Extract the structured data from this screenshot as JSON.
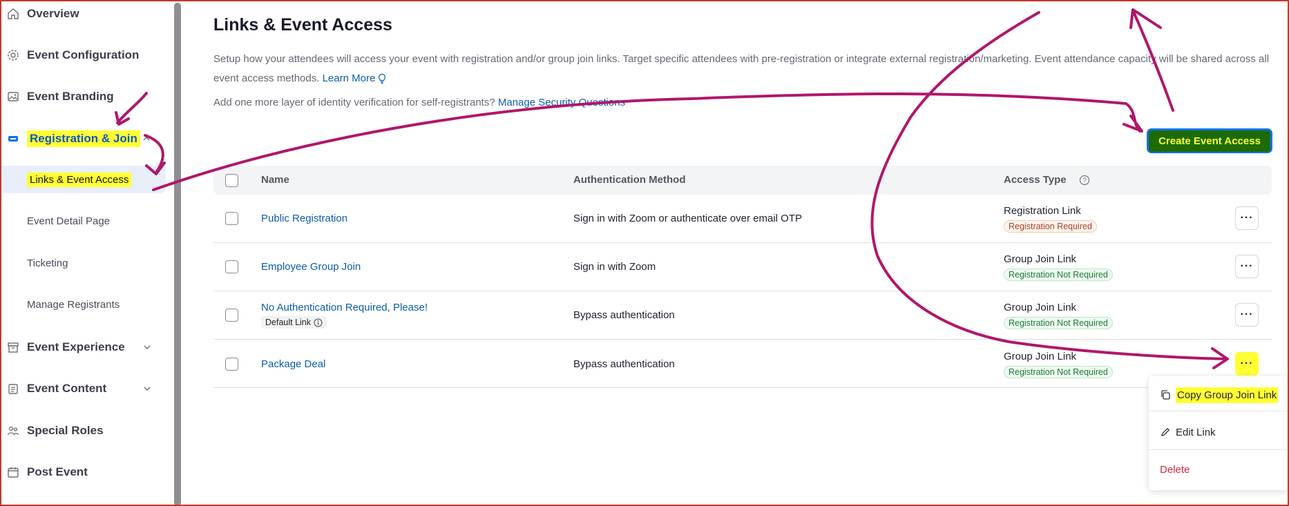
{
  "sidebar": {
    "items": [
      {
        "label": "Overview",
        "icon": "home-icon"
      },
      {
        "label": "Event Configuration",
        "icon": "gear-icon"
      },
      {
        "label": "Event Branding",
        "icon": "image-icon"
      },
      {
        "label": "Registration & Join",
        "icon": "ticket-icon",
        "expanded": true
      },
      {
        "label": "Event Experience",
        "icon": "archive-icon"
      },
      {
        "label": "Event Content",
        "icon": "clipboard-icon"
      },
      {
        "label": "Special Roles",
        "icon": "people-icon"
      },
      {
        "label": "Post Event",
        "icon": "calendar-icon"
      }
    ],
    "subitems": [
      {
        "label": "Links & Event Access",
        "active": true
      },
      {
        "label": "Event Detail Page"
      },
      {
        "label": "Ticketing"
      },
      {
        "label": "Manage Registrants"
      }
    ]
  },
  "main": {
    "title": "Links & Event Access",
    "description": "Setup how your attendees will access your event with registration and/or group join links. Target specific attendees with pre-registration or integrate external registration/marketing. Event attendance capacity will be shared across all event access methods.",
    "learn_more": "Learn More",
    "verify_text": "Add one more layer of identity verification for self-registrants?",
    "verify_link": "Manage Security Questions",
    "create_button": "Create Event Access"
  },
  "table": {
    "headers": {
      "name": "Name",
      "auth": "Authentication Method",
      "type": "Access Type"
    },
    "rows": [
      {
        "name": "Public Registration",
        "auth": "Sign in with Zoom or authenticate over email OTP",
        "type": "Registration Link",
        "badge": "Registration Required"
      },
      {
        "name": "Employee Group Join",
        "auth": "Sign in with Zoom",
        "type": "Group Join Link",
        "badge": "Registration Not Required"
      },
      {
        "name": "No Authentication Required, Please!",
        "default_chip": "Default Link",
        "auth": "Bypass authentication",
        "type": "Group Join Link",
        "badge": "Registration Not Required"
      },
      {
        "name": "Package Deal",
        "auth": "Bypass authentication",
        "type": "Group Join Link",
        "badge": "Registration Not Required"
      }
    ],
    "more_label": "···"
  },
  "menu": {
    "copy": "Copy Group Join Link",
    "edit": "Edit Link",
    "delete": "Delete"
  },
  "colors": {
    "accent": "#0e72ed",
    "link": "#0b5cad",
    "highlight": "#ffff33",
    "annotation": "#b0176b"
  }
}
